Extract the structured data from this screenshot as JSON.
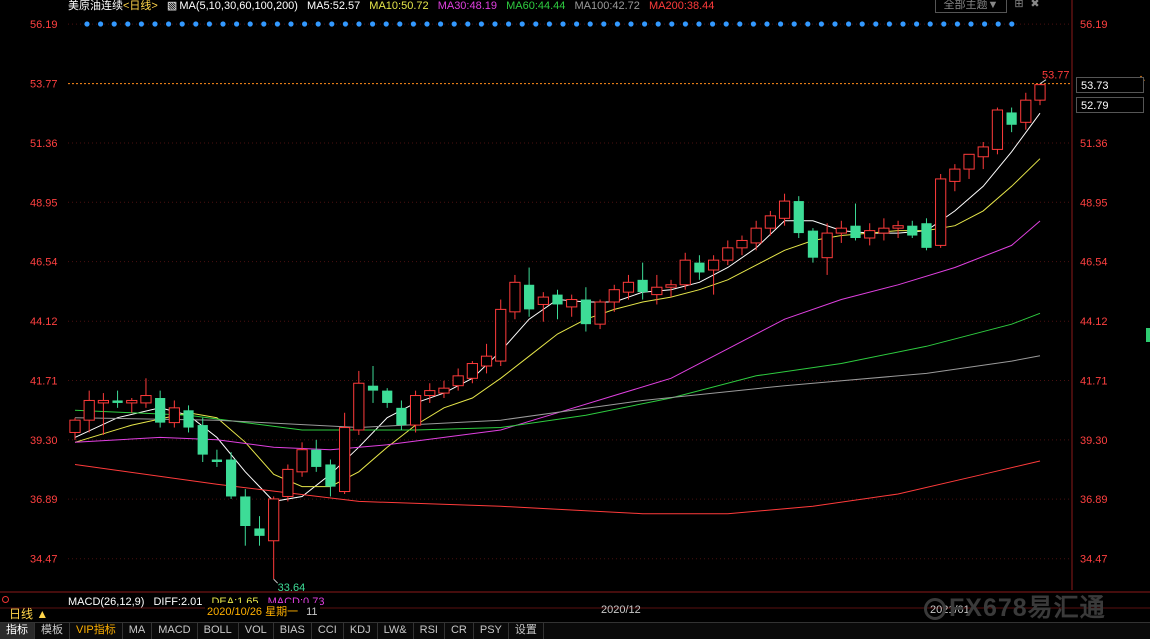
{
  "header": {
    "instrument": "美原油连续",
    "period_tag": "<日线>",
    "ma_set": "MA(5,10,30,60,100,200)",
    "ma_values": [
      {
        "label": "MA5:52.57",
        "color": "#ffffff"
      },
      {
        "label": "MA10:50.72",
        "color": "#e6e64a"
      },
      {
        "label": "MA30:48.19",
        "color": "#e040e0"
      },
      {
        "label": "MA60:44.44",
        "color": "#2ecc40"
      },
      {
        "label": "MA100:42.72",
        "color": "#9a9a9a"
      },
      {
        "label": "MA200:38.44",
        "color": "#ff3b3b"
      }
    ],
    "theme_button": "全部主题▼",
    "corner_icons": [
      "⊞",
      "✖"
    ]
  },
  "price_tags": {
    "last": "53.73",
    "secondary": "52.79"
  },
  "annotations": {
    "high_label": "53.77",
    "low_label": "33.64"
  },
  "macd": {
    "label": "MACD(26,12,9)",
    "diff": "DIFF:2.01",
    "dea": "DEA:1.65",
    "macd": "MACD:0.73"
  },
  "footer": {
    "period": "日线 ▲",
    "date_tip": "2020/10/26 星期一",
    "date_tip_suffix": "11",
    "axis_dates": [
      "2020/12",
      "2021/01"
    ],
    "watermark": "FX678易汇通"
  },
  "tabs": [
    "指标",
    "模板",
    "VIP指标",
    "MA",
    "MACD",
    "BOLL",
    "VOL",
    "BIAS",
    "CCI",
    "KDJ",
    "LW&",
    "RSI",
    "CR",
    "PSY",
    "设置"
  ],
  "colors": {
    "up": "#ff3b3b",
    "down": "#3ddc97",
    "grid": "#4a1010",
    "axis_text": "#ff4040"
  },
  "chart_data": {
    "type": "candlestick",
    "y_ticks": [
      56.19,
      53.77,
      51.36,
      48.95,
      46.54,
      44.12,
      41.71,
      39.3,
      36.89,
      34.47
    ],
    "ylim": [
      33.2,
      56.6
    ],
    "last_price_line": 53.77,
    "candles": [
      {
        "o": 39.6,
        "h": 40.2,
        "l": 39.3,
        "c": 40.1
      },
      {
        "o": 40.1,
        "h": 41.3,
        "l": 39.6,
        "c": 40.9
      },
      {
        "o": 40.8,
        "h": 41.2,
        "l": 39.5,
        "c": 40.9
      },
      {
        "o": 40.9,
        "h": 41.3,
        "l": 40.6,
        "c": 40.8
      },
      {
        "o": 40.8,
        "h": 41.0,
        "l": 40.4,
        "c": 40.9
      },
      {
        "o": 40.8,
        "h": 41.8,
        "l": 40.6,
        "c": 41.1
      },
      {
        "o": 41.0,
        "h": 41.3,
        "l": 39.8,
        "c": 40.0
      },
      {
        "o": 40.0,
        "h": 40.9,
        "l": 39.8,
        "c": 40.6
      },
      {
        "o": 40.5,
        "h": 40.7,
        "l": 39.6,
        "c": 39.8
      },
      {
        "o": 39.9,
        "h": 40.2,
        "l": 38.4,
        "c": 38.7
      },
      {
        "o": 38.5,
        "h": 38.9,
        "l": 38.2,
        "c": 38.4
      },
      {
        "o": 38.5,
        "h": 38.8,
        "l": 36.9,
        "c": 37.0
      },
      {
        "o": 37.0,
        "h": 37.3,
        "l": 35.0,
        "c": 35.8
      },
      {
        "o": 35.7,
        "h": 36.2,
        "l": 35.0,
        "c": 35.4
      },
      {
        "o": 35.2,
        "h": 37.0,
        "l": 33.64,
        "c": 36.9
      },
      {
        "o": 37.0,
        "h": 38.3,
        "l": 36.8,
        "c": 38.1
      },
      {
        "o": 38.0,
        "h": 39.2,
        "l": 37.8,
        "c": 38.9
      },
      {
        "o": 38.9,
        "h": 39.3,
        "l": 38.0,
        "c": 38.2
      },
      {
        "o": 38.3,
        "h": 38.5,
        "l": 37.0,
        "c": 37.4
      },
      {
        "o": 37.2,
        "h": 40.4,
        "l": 37.1,
        "c": 39.8
      },
      {
        "o": 39.7,
        "h": 42.1,
        "l": 39.5,
        "c": 41.6
      },
      {
        "o": 41.5,
        "h": 42.3,
        "l": 40.8,
        "c": 41.3
      },
      {
        "o": 41.3,
        "h": 41.4,
        "l": 40.6,
        "c": 40.8
      },
      {
        "o": 40.6,
        "h": 40.9,
        "l": 39.7,
        "c": 39.9
      },
      {
        "o": 39.9,
        "h": 41.3,
        "l": 39.6,
        "c": 41.1
      },
      {
        "o": 41.1,
        "h": 41.6,
        "l": 40.8,
        "c": 41.3
      },
      {
        "o": 41.2,
        "h": 41.7,
        "l": 41.0,
        "c": 41.4
      },
      {
        "o": 41.5,
        "h": 42.2,
        "l": 41.3,
        "c": 41.9
      },
      {
        "o": 41.8,
        "h": 42.5,
        "l": 41.6,
        "c": 42.4
      },
      {
        "o": 42.3,
        "h": 43.2,
        "l": 42.0,
        "c": 42.7
      },
      {
        "o": 42.5,
        "h": 45.0,
        "l": 42.3,
        "c": 44.6
      },
      {
        "o": 44.5,
        "h": 46.0,
        "l": 44.2,
        "c": 45.7
      },
      {
        "o": 45.6,
        "h": 46.3,
        "l": 44.3,
        "c": 44.6
      },
      {
        "o": 44.8,
        "h": 45.3,
        "l": 44.1,
        "c": 45.1
      },
      {
        "o": 45.2,
        "h": 45.4,
        "l": 44.2,
        "c": 44.8
      },
      {
        "o": 44.7,
        "h": 45.2,
        "l": 44.3,
        "c": 45.0
      },
      {
        "o": 45.0,
        "h": 45.5,
        "l": 43.7,
        "c": 44.0
      },
      {
        "o": 44.0,
        "h": 45.0,
        "l": 43.8,
        "c": 44.9
      },
      {
        "o": 44.9,
        "h": 45.6,
        "l": 44.5,
        "c": 45.4
      },
      {
        "o": 45.3,
        "h": 46.0,
        "l": 45.0,
        "c": 45.7
      },
      {
        "o": 45.8,
        "h": 46.5,
        "l": 45.0,
        "c": 45.3
      },
      {
        "o": 45.2,
        "h": 46.0,
        "l": 44.8,
        "c": 45.5
      },
      {
        "o": 45.5,
        "h": 45.8,
        "l": 45.1,
        "c": 45.6
      },
      {
        "o": 45.6,
        "h": 46.9,
        "l": 45.4,
        "c": 46.6
      },
      {
        "o": 46.5,
        "h": 46.8,
        "l": 45.8,
        "c": 46.1
      },
      {
        "o": 46.2,
        "h": 46.8,
        "l": 45.2,
        "c": 46.6
      },
      {
        "o": 46.6,
        "h": 47.4,
        "l": 46.4,
        "c": 47.1
      },
      {
        "o": 47.1,
        "h": 47.6,
        "l": 46.8,
        "c": 47.4
      },
      {
        "o": 47.3,
        "h": 48.2,
        "l": 47.0,
        "c": 47.9
      },
      {
        "o": 47.9,
        "h": 48.6,
        "l": 47.6,
        "c": 48.4
      },
      {
        "o": 48.3,
        "h": 49.3,
        "l": 48.0,
        "c": 49.0
      },
      {
        "o": 49.0,
        "h": 49.2,
        "l": 47.5,
        "c": 47.7
      },
      {
        "o": 47.8,
        "h": 47.9,
        "l": 46.5,
        "c": 46.7
      },
      {
        "o": 46.7,
        "h": 48.1,
        "l": 46.0,
        "c": 47.7
      },
      {
        "o": 47.7,
        "h": 48.2,
        "l": 47.3,
        "c": 47.9
      },
      {
        "o": 48.0,
        "h": 48.9,
        "l": 47.4,
        "c": 47.5
      },
      {
        "o": 47.5,
        "h": 48.1,
        "l": 47.2,
        "c": 47.8
      },
      {
        "o": 47.7,
        "h": 48.3,
        "l": 47.4,
        "c": 47.9
      },
      {
        "o": 47.9,
        "h": 48.2,
        "l": 47.5,
        "c": 48.0
      },
      {
        "o": 48.0,
        "h": 48.2,
        "l": 47.5,
        "c": 47.6
      },
      {
        "o": 48.1,
        "h": 48.3,
        "l": 47.0,
        "c": 47.1
      },
      {
        "o": 47.2,
        "h": 50.1,
        "l": 47.1,
        "c": 49.9
      },
      {
        "o": 49.8,
        "h": 50.5,
        "l": 49.4,
        "c": 50.3
      },
      {
        "o": 50.3,
        "h": 50.9,
        "l": 49.9,
        "c": 50.9
      },
      {
        "o": 50.8,
        "h": 51.4,
        "l": 50.3,
        "c": 51.2
      },
      {
        "o": 51.1,
        "h": 52.8,
        "l": 50.9,
        "c": 52.7
      },
      {
        "o": 52.6,
        "h": 52.8,
        "l": 51.8,
        "c": 52.1
      },
      {
        "o": 52.2,
        "h": 53.4,
        "l": 51.9,
        "c": 53.1
      },
      {
        "o": 53.1,
        "h": 53.77,
        "l": 52.9,
        "c": 53.73
      }
    ],
    "ma_series": [
      {
        "name": "MA5",
        "color": "#ffffff",
        "points": [
          [
            0,
            39.4
          ],
          [
            3,
            40.2
          ],
          [
            6,
            40.6
          ],
          [
            8,
            40.3
          ],
          [
            10,
            39.4
          ],
          [
            12,
            38.0
          ],
          [
            14,
            36.8
          ],
          [
            16,
            37.0
          ],
          [
            18,
            37.9
          ],
          [
            20,
            39.0
          ],
          [
            22,
            40.2
          ],
          [
            24,
            40.8
          ],
          [
            26,
            41.2
          ],
          [
            28,
            41.8
          ],
          [
            30,
            42.9
          ],
          [
            32,
            44.2
          ],
          [
            34,
            45.0
          ],
          [
            36,
            44.9
          ],
          [
            38,
            44.9
          ],
          [
            40,
            45.3
          ],
          [
            42,
            45.4
          ],
          [
            44,
            45.7
          ],
          [
            46,
            46.3
          ],
          [
            48,
            47.1
          ],
          [
            50,
            48.2
          ],
          [
            52,
            48.2
          ],
          [
            54,
            47.8
          ],
          [
            56,
            47.7
          ],
          [
            58,
            47.7
          ],
          [
            60,
            47.8
          ],
          [
            62,
            48.6
          ],
          [
            64,
            49.6
          ],
          [
            66,
            51.0
          ],
          [
            68,
            52.57
          ]
        ]
      },
      {
        "name": "MA10",
        "color": "#e6e64a",
        "points": [
          [
            0,
            39.2
          ],
          [
            4,
            39.9
          ],
          [
            8,
            40.4
          ],
          [
            10,
            40.2
          ],
          [
            12,
            39.2
          ],
          [
            14,
            37.9
          ],
          [
            16,
            37.4
          ],
          [
            18,
            37.4
          ],
          [
            20,
            38.0
          ],
          [
            22,
            39.0
          ],
          [
            24,
            39.9
          ],
          [
            26,
            40.6
          ],
          [
            28,
            41.0
          ],
          [
            30,
            41.8
          ],
          [
            32,
            42.7
          ],
          [
            34,
            43.6
          ],
          [
            36,
            44.2
          ],
          [
            38,
            44.6
          ],
          [
            40,
            44.9
          ],
          [
            42,
            45.1
          ],
          [
            44,
            45.4
          ],
          [
            46,
            45.8
          ],
          [
            48,
            46.4
          ],
          [
            50,
            47.0
          ],
          [
            52,
            47.4
          ],
          [
            54,
            47.6
          ],
          [
            56,
            47.7
          ],
          [
            58,
            47.8
          ],
          [
            60,
            47.8
          ],
          [
            62,
            48.0
          ],
          [
            64,
            48.6
          ],
          [
            66,
            49.6
          ],
          [
            68,
            50.72
          ]
        ]
      },
      {
        "name": "MA30",
        "color": "#e040e0",
        "points": [
          [
            0,
            39.2
          ],
          [
            6,
            39.4
          ],
          [
            10,
            39.3
          ],
          [
            14,
            39.0
          ],
          [
            18,
            38.9
          ],
          [
            22,
            39.1
          ],
          [
            26,
            39.4
          ],
          [
            30,
            39.7
          ],
          [
            34,
            40.4
          ],
          [
            38,
            41.1
          ],
          [
            42,
            41.8
          ],
          [
            46,
            43.0
          ],
          [
            50,
            44.2
          ],
          [
            54,
            45.0
          ],
          [
            58,
            45.6
          ],
          [
            62,
            46.3
          ],
          [
            66,
            47.2
          ],
          [
            68,
            48.19
          ]
        ]
      },
      {
        "name": "MA60",
        "color": "#2ecc40",
        "points": [
          [
            0,
            40.5
          ],
          [
            8,
            40.3
          ],
          [
            16,
            39.7
          ],
          [
            24,
            39.7
          ],
          [
            30,
            39.8
          ],
          [
            36,
            40.3
          ],
          [
            42,
            41.0
          ],
          [
            48,
            41.9
          ],
          [
            54,
            42.4
          ],
          [
            60,
            43.1
          ],
          [
            66,
            44.0
          ],
          [
            68,
            44.44
          ]
        ]
      },
      {
        "name": "MA100",
        "color": "#9a9a9a",
        "points": [
          [
            0,
            40.2
          ],
          [
            10,
            40.1
          ],
          [
            20,
            39.8
          ],
          [
            30,
            40.1
          ],
          [
            40,
            40.9
          ],
          [
            50,
            41.5
          ],
          [
            60,
            42.0
          ],
          [
            66,
            42.5
          ],
          [
            68,
            42.72
          ]
        ]
      },
      {
        "name": "MA200",
        "color": "#ff3b3b",
        "points": [
          [
            0,
            38.3
          ],
          [
            10,
            37.5
          ],
          [
            20,
            36.8
          ],
          [
            30,
            36.6
          ],
          [
            40,
            36.3
          ],
          [
            46,
            36.3
          ],
          [
            52,
            36.6
          ],
          [
            58,
            37.1
          ],
          [
            64,
            37.9
          ],
          [
            68,
            38.44
          ]
        ]
      }
    ]
  }
}
